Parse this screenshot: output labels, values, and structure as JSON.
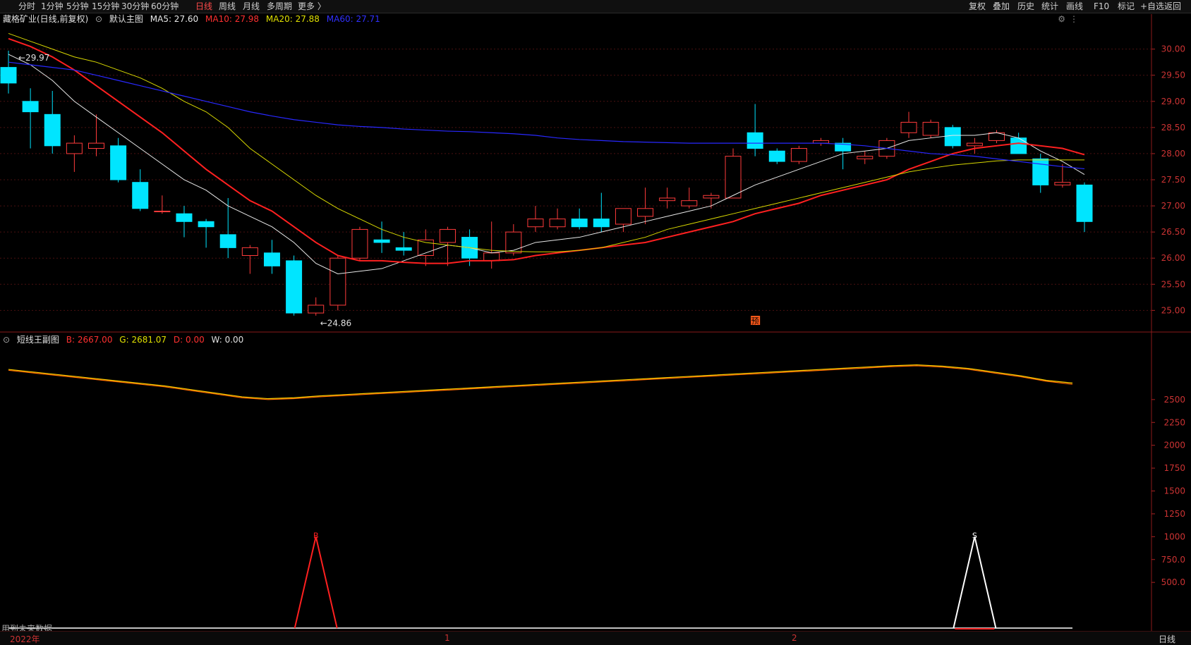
{
  "toolbar": {
    "items": [
      "分时",
      "1分钟",
      "5分钟",
      "15分钟",
      "30分钟",
      "60分钟",
      "日线",
      "周线",
      "月线",
      "多周期",
      "更多 〉"
    ],
    "active_index": 6,
    "right_items": [
      "复权",
      "叠加",
      "历史",
      "统计",
      "画线",
      "F10",
      "标记",
      "+自选",
      "返回"
    ]
  },
  "main_legend": {
    "stock": "藏格矿业(日线,前复权)",
    "chart_name": "默认主图",
    "ma5": "MA5: 27.60",
    "ma10": "MA10: 27.98",
    "ma20": "MA20: 27.88",
    "ma60": "MA60: 27.71"
  },
  "sub_legend": {
    "chart_name": "短线王副图",
    "b": "B: 2667.00",
    "g": "G: 2681.07",
    "d": "D: 0.00",
    "w": "W: 0.00"
  },
  "annotations": {
    "high": "29.97",
    "low": "24.86",
    "pre_marker": "预",
    "b_marker": "B",
    "s_marker": "S",
    "footer_note": "用到未来数据"
  },
  "timeline": {
    "year": "2022年",
    "m1": "1",
    "m2": "2",
    "period": "日线"
  },
  "colors": {
    "up": "#ff3b3b",
    "down": "#00e5ff",
    "ma5": "#e8e8e8",
    "ma10": "#ff2020",
    "ma20": "#d8d800",
    "ma60": "#2828ff",
    "axis": "#cc2222"
  },
  "chart_data": [
    {
      "type": "candlestick",
      "title": "",
      "ylim": [
        24.6,
        30.4
      ],
      "y_ticks": [
        25.0,
        25.5,
        26.0,
        26.5,
        27.0,
        27.5,
        28.0,
        28.5,
        29.0,
        29.5,
        30.0
      ],
      "candles": [
        {
          "o": 29.65,
          "h": 29.97,
          "l": 29.15,
          "c": 29.35
        },
        {
          "o": 29.0,
          "h": 29.25,
          "l": 28.1,
          "c": 28.8
        },
        {
          "o": 28.75,
          "h": 29.2,
          "l": 28.0,
          "c": 28.15
        },
        {
          "o": 28.0,
          "h": 28.35,
          "l": 27.65,
          "c": 28.2
        },
        {
          "o": 28.1,
          "h": 28.75,
          "l": 27.95,
          "c": 28.2
        },
        {
          "o": 28.15,
          "h": 28.3,
          "l": 27.45,
          "c": 27.5
        },
        {
          "o": 27.45,
          "h": 27.7,
          "l": 26.9,
          "c": 26.95
        },
        {
          "o": 26.9,
          "h": 27.2,
          "l": 26.85,
          "c": 26.9
        },
        {
          "o": 26.85,
          "h": 27.0,
          "l": 26.4,
          "c": 26.7
        },
        {
          "o": 26.7,
          "h": 26.75,
          "l": 26.2,
          "c": 26.6
        },
        {
          "o": 26.45,
          "h": 27.15,
          "l": 26.0,
          "c": 26.2
        },
        {
          "o": 26.05,
          "h": 26.25,
          "l": 25.7,
          "c": 26.2
        },
        {
          "o": 26.1,
          "h": 26.35,
          "l": 25.7,
          "c": 25.85
        },
        {
          "o": 25.95,
          "h": 26.05,
          "l": 24.9,
          "c": 24.95
        },
        {
          "o": 24.95,
          "h": 25.25,
          "l": 24.9,
          "c": 25.1
        },
        {
          "o": 25.1,
          "h": 26.05,
          "l": 25.0,
          "c": 26.0
        },
        {
          "o": 26.0,
          "h": 26.6,
          "l": 25.95,
          "c": 26.55
        },
        {
          "o": 26.35,
          "h": 26.7,
          "l": 26.1,
          "c": 26.3
        },
        {
          "o": 26.2,
          "h": 26.5,
          "l": 26.05,
          "c": 26.15
        },
        {
          "o": 26.05,
          "h": 26.55,
          "l": 25.85,
          "c": 26.35
        },
        {
          "o": 26.3,
          "h": 26.6,
          "l": 25.85,
          "c": 26.55
        },
        {
          "o": 26.4,
          "h": 26.55,
          "l": 25.85,
          "c": 26.0
        },
        {
          "o": 25.95,
          "h": 26.7,
          "l": 25.8,
          "c": 26.1
        },
        {
          "o": 26.1,
          "h": 26.65,
          "l": 26.05,
          "c": 26.5
        },
        {
          "o": 26.6,
          "h": 27.0,
          "l": 26.5,
          "c": 26.75
        },
        {
          "o": 26.6,
          "h": 26.95,
          "l": 26.55,
          "c": 26.75
        },
        {
          "o": 26.75,
          "h": 26.95,
          "l": 26.55,
          "c": 26.6
        },
        {
          "o": 26.75,
          "h": 27.25,
          "l": 26.5,
          "c": 26.6
        },
        {
          "o": 26.65,
          "h": 26.95,
          "l": 26.5,
          "c": 26.95
        },
        {
          "o": 26.8,
          "h": 27.35,
          "l": 26.65,
          "c": 26.95
        },
        {
          "o": 27.1,
          "h": 27.35,
          "l": 26.95,
          "c": 27.15
        },
        {
          "o": 27.0,
          "h": 27.35,
          "l": 26.95,
          "c": 27.1
        },
        {
          "o": 27.15,
          "h": 27.25,
          "l": 26.95,
          "c": 27.2
        },
        {
          "o": 27.15,
          "h": 28.1,
          "l": 27.15,
          "c": 27.95
        },
        {
          "o": 28.4,
          "h": 28.95,
          "l": 27.95,
          "c": 28.1
        },
        {
          "o": 28.05,
          "h": 28.1,
          "l": 27.8,
          "c": 27.85
        },
        {
          "o": 27.85,
          "h": 28.15,
          "l": 27.8,
          "c": 28.1
        },
        {
          "o": 28.2,
          "h": 28.3,
          "l": 28.15,
          "c": 28.25
        },
        {
          "o": 28.2,
          "h": 28.3,
          "l": 27.7,
          "c": 28.05
        },
        {
          "o": 27.9,
          "h": 28.05,
          "l": 27.8,
          "c": 27.95
        },
        {
          "o": 27.95,
          "h": 28.3,
          "l": 27.9,
          "c": 28.25
        },
        {
          "o": 28.4,
          "h": 28.8,
          "l": 28.3,
          "c": 28.6
        },
        {
          "o": 28.35,
          "h": 28.65,
          "l": 28.3,
          "c": 28.6
        },
        {
          "o": 28.5,
          "h": 28.55,
          "l": 28.1,
          "c": 28.15
        },
        {
          "o": 28.15,
          "h": 28.3,
          "l": 28.0,
          "c": 28.2
        },
        {
          "o": 28.25,
          "h": 28.45,
          "l": 28.2,
          "c": 28.4
        },
        {
          "o": 28.3,
          "h": 28.4,
          "l": 28.0,
          "c": 28.0
        },
        {
          "o": 27.9,
          "h": 28.0,
          "l": 27.25,
          "c": 27.4
        },
        {
          "o": 27.4,
          "h": 27.8,
          "l": 27.35,
          "c": 27.45
        },
        {
          "o": 27.4,
          "h": 27.45,
          "l": 26.5,
          "c": 26.7
        }
      ],
      "ma_series": [
        {
          "name": "MA5",
          "points": [
            29.9,
            29.7,
            29.4,
            29.0,
            28.7,
            28.4,
            28.1,
            27.8,
            27.5,
            27.3,
            27.0,
            26.8,
            26.6,
            26.3,
            25.9,
            25.7,
            25.75,
            25.8,
            25.95,
            26.1,
            26.25,
            26.2,
            26.1,
            26.15,
            26.3,
            26.35,
            26.4,
            26.5,
            26.6,
            26.7,
            26.8,
            26.9,
            27.0,
            27.2,
            27.4,
            27.55,
            27.7,
            27.85,
            28.0,
            28.05,
            28.1,
            28.25,
            28.3,
            28.35,
            28.35,
            28.4,
            28.3,
            28.05,
            27.85,
            27.6
          ]
        },
        {
          "name": "MA10",
          "points": [
            30.2,
            30.05,
            29.85,
            29.6,
            29.3,
            29.0,
            28.7,
            28.4,
            28.05,
            27.7,
            27.4,
            27.1,
            26.9,
            26.6,
            26.3,
            26.05,
            25.95,
            25.95,
            25.92,
            25.9,
            25.9,
            25.95,
            25.95,
            25.97,
            26.05,
            26.1,
            26.15,
            26.2,
            26.25,
            26.3,
            26.4,
            26.5,
            26.6,
            26.7,
            26.85,
            26.95,
            27.05,
            27.2,
            27.3,
            27.4,
            27.5,
            27.7,
            27.85,
            28.0,
            28.1,
            28.15,
            28.2,
            28.15,
            28.1,
            27.98
          ]
        },
        {
          "name": "MA20",
          "points": [
            30.3,
            30.15,
            30.0,
            29.85,
            29.75,
            29.6,
            29.45,
            29.25,
            29.0,
            28.8,
            28.5,
            28.1,
            27.8,
            27.5,
            27.2,
            26.95,
            26.75,
            26.55,
            26.4,
            26.3,
            26.25,
            26.2,
            26.15,
            26.13,
            26.12,
            26.12,
            26.15,
            26.2,
            26.3,
            26.4,
            26.55,
            26.65,
            26.75,
            26.85,
            26.95,
            27.05,
            27.15,
            27.25,
            27.35,
            27.45,
            27.55,
            27.65,
            27.72,
            27.78,
            27.82,
            27.86,
            27.88,
            27.88,
            27.88,
            27.88
          ]
        },
        {
          "name": "MA60",
          "points": [
            29.75,
            29.7,
            29.65,
            29.6,
            29.5,
            29.4,
            29.3,
            29.2,
            29.1,
            29.0,
            28.9,
            28.8,
            28.72,
            28.65,
            28.6,
            28.55,
            28.52,
            28.5,
            28.47,
            28.45,
            28.43,
            28.42,
            28.4,
            28.38,
            28.35,
            28.3,
            28.27,
            28.25,
            28.23,
            28.22,
            28.21,
            28.2,
            28.2,
            28.2,
            28.2,
            28.2,
            28.2,
            28.2,
            28.18,
            28.15,
            28.1,
            28.05,
            28.0,
            27.98,
            27.95,
            27.9,
            27.85,
            27.8,
            27.75,
            27.71
          ]
        }
      ]
    },
    {
      "type": "line",
      "title": "",
      "ylim": [
        0,
        3000
      ],
      "y_ticks": [
        500,
        750,
        1000,
        1250,
        1500,
        1750,
        2000,
        2250,
        2500
      ],
      "y_tick_labels": [
        "500.0",
        "750.0",
        "1000",
        "1250",
        "1500",
        "1750",
        "2000",
        "2250",
        "2500"
      ],
      "series": [
        {
          "name": "B",
          "color": "#ff6a00",
          "points": [
            2820,
            2790,
            2760,
            2730,
            2700,
            2670,
            2640,
            2600,
            2560,
            2520,
            2500,
            2510,
            2530,
            2545,
            2560,
            2575,
            2590,
            2605,
            2620,
            2635,
            2650,
            2665,
            2680,
            2695,
            2710,
            2725,
            2740,
            2755,
            2770,
            2785,
            2800,
            2815,
            2830,
            2845,
            2860,
            2870,
            2855,
            2830,
            2790,
            2750,
            2700,
            2667
          ]
        },
        {
          "name": "G",
          "color": "#ffd000",
          "points": [
            2830,
            2800,
            2770,
            2740,
            2710,
            2680,
            2650,
            2610,
            2570,
            2530,
            2510,
            2520,
            2540,
            2555,
            2570,
            2585,
            2600,
            2615,
            2630,
            2645,
            2660,
            2675,
            2690,
            2705,
            2720,
            2735,
            2750,
            2765,
            2780,
            2795,
            2810,
            2825,
            2840,
            2855,
            2870,
            2880,
            2865,
            2840,
            2800,
            2760,
            2710,
            2681.07
          ]
        }
      ],
      "signal_peaks": [
        {
          "label": "B",
          "index": 14,
          "value": 1000,
          "color": "#ff2020"
        },
        {
          "label": "S",
          "index": 44,
          "value": 1000,
          "color": "#ffffff"
        }
      ]
    }
  ]
}
